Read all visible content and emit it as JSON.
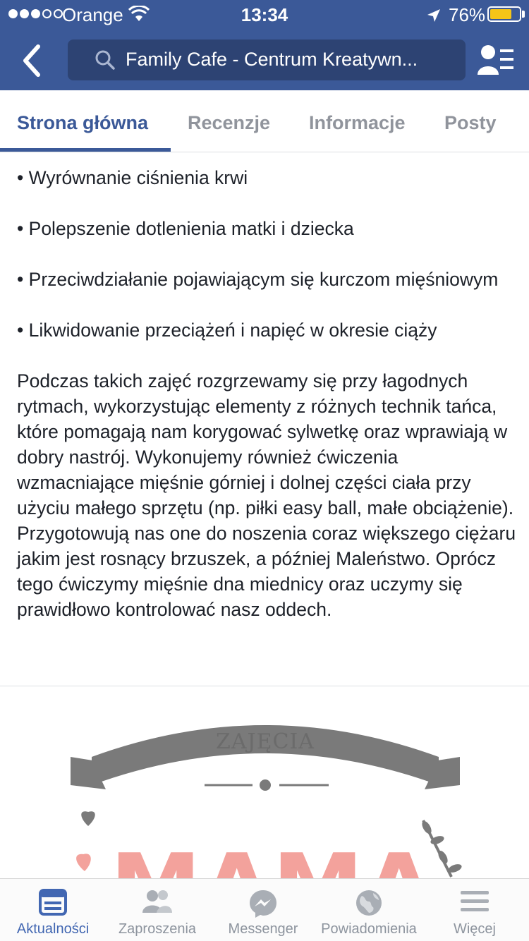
{
  "status_bar": {
    "carrier": "Orange",
    "time": "13:34",
    "battery_percent_text": "76%",
    "battery_level": 0.76,
    "signal_bars_filled": 3,
    "signal_bars_total": 5
  },
  "nav": {
    "search_text": "Family Cafe - Centrum Kreatywn..."
  },
  "tabs": [
    {
      "label": "Strona główna",
      "active": true
    },
    {
      "label": "Recenzje",
      "active": false
    },
    {
      "label": "Informacje",
      "active": false
    },
    {
      "label": "Posty",
      "active": false
    }
  ],
  "content": {
    "bullets": [
      "• Wyrównanie ciśnienia krwi",
      "• Polepszenie dotlenienia matki i dziecka",
      "• Przeciwdziałanie pojawiającym się kurczom mięśniowym",
      "• Likwidowanie przeciążeń i napięć w okresie ciąży"
    ],
    "paragraph": "Podczas takich zajęć rozgrzewamy się przy łagodnych rytmach, wykorzystując elementy z różnych technik tańca, które pomagają nam korygować sylwetkę oraz wprawiają w dobry nastrój. Wykonujemy również ćwiczenia wzmacniające mięśnie górniej i dolnej części ciała przy użyciu małego sprzętu (np. piłki easy ball, małe obciążenie). Przygotowują nas one do noszenia coraz większego ciężaru jakim jest rosnący brzuszek, a później Maleństwo. Oprócz tego ćwiczymy mięśnie dna miednicy oraz uczymy się prawidłowo kontrolować nasz oddech."
  },
  "image": {
    "banner_text": "ZAJĘCIA",
    "title_text": "MAMA"
  },
  "bottom_bar": [
    {
      "label": "Aktualności",
      "icon": "news-feed-icon",
      "active": true
    },
    {
      "label": "Zaproszenia",
      "icon": "friend-requests-icon",
      "active": false
    },
    {
      "label": "Messenger",
      "icon": "messenger-icon",
      "active": false
    },
    {
      "label": "Powiadomienia",
      "icon": "globe-notifications-icon",
      "active": false
    },
    {
      "label": "Więcej",
      "icon": "menu-icon",
      "active": false
    }
  ],
  "colors": {
    "brand": "#3b5998",
    "active_tab": "#3b5998",
    "battery": "#f5c518",
    "inactive": "#90949c",
    "logo_pink": "#f3a29c",
    "logo_gray": "#7a7a7a"
  }
}
